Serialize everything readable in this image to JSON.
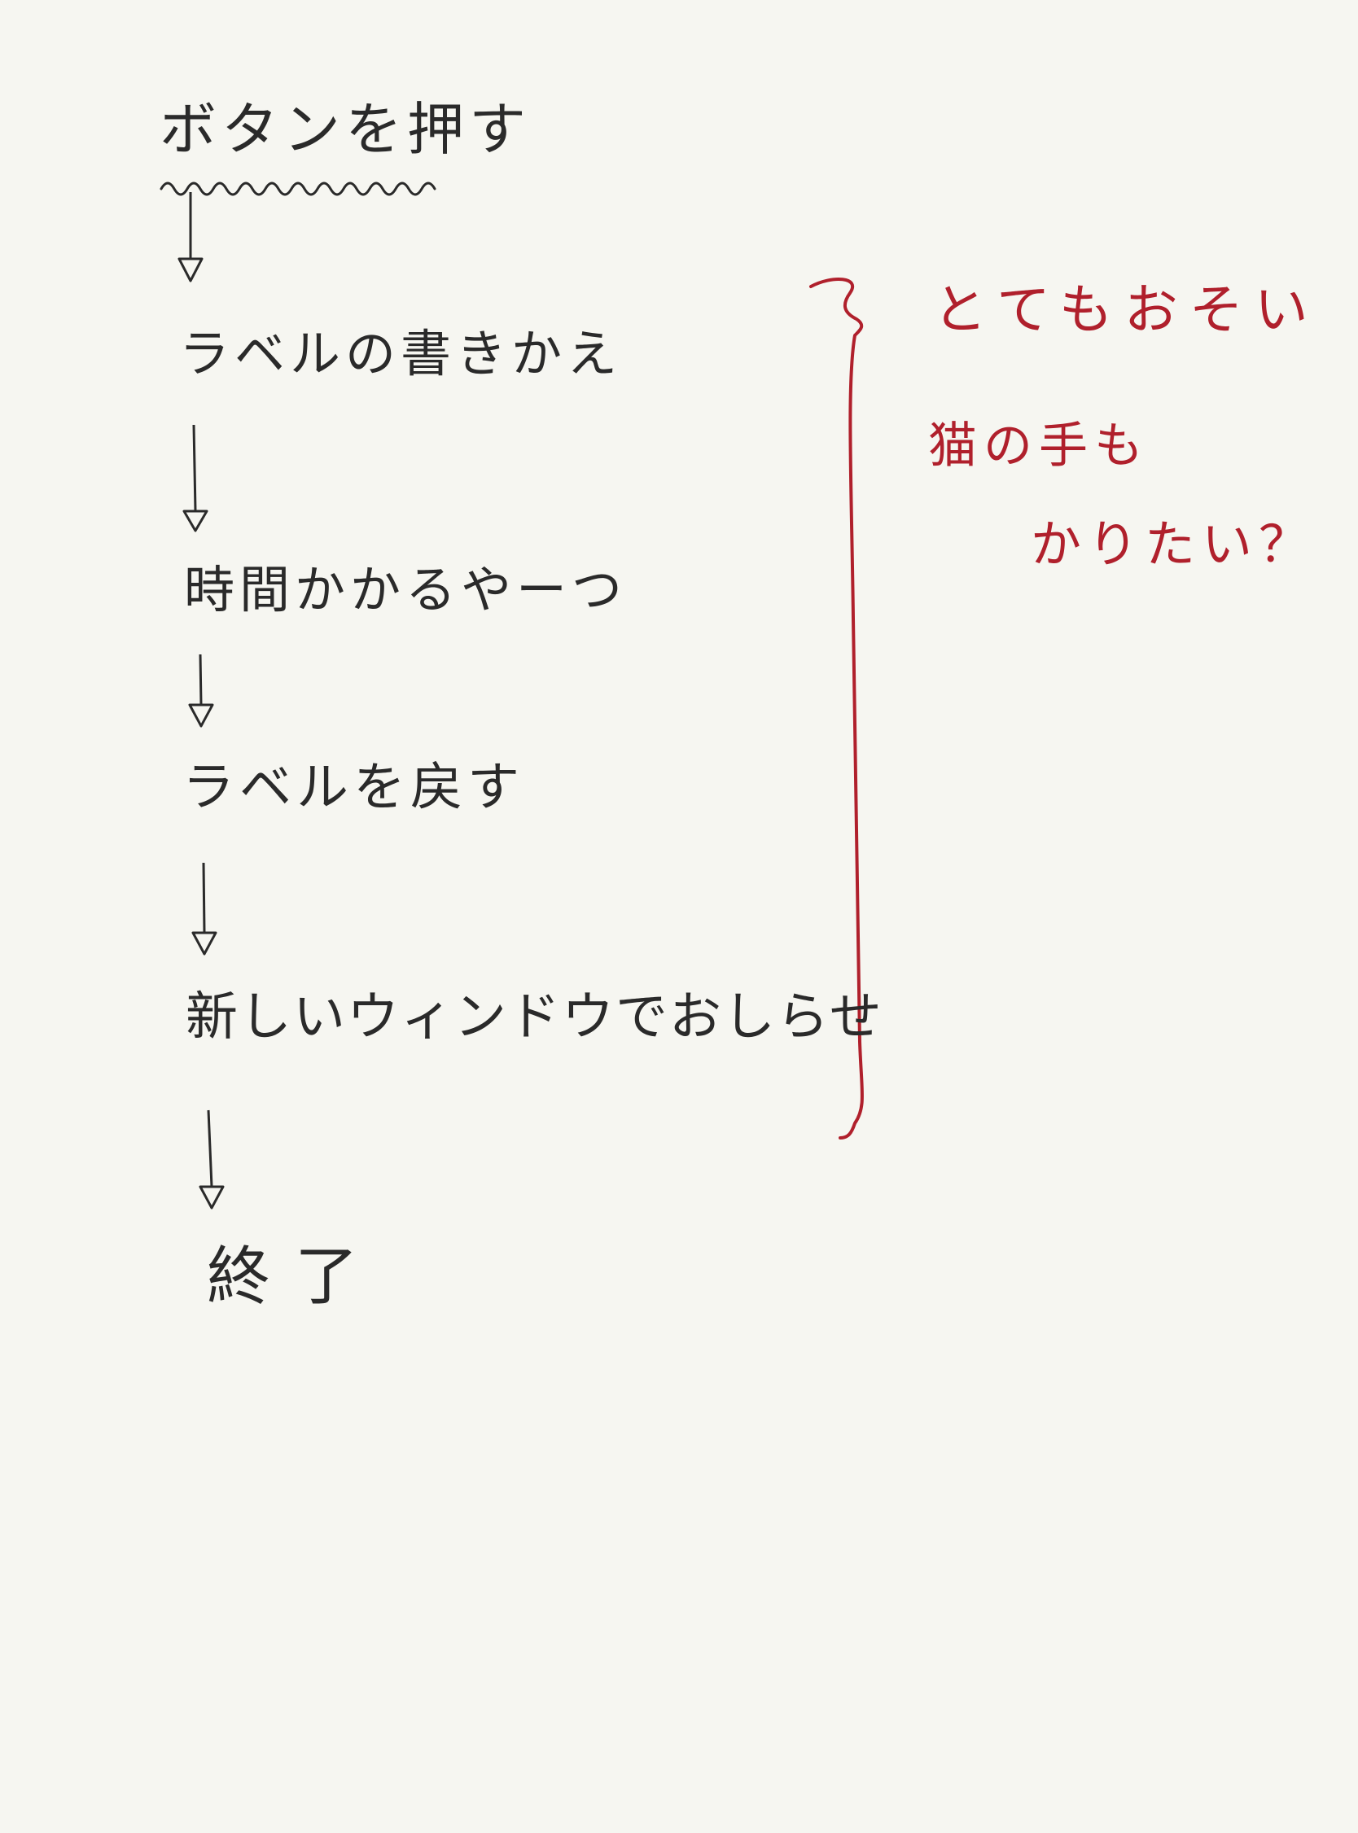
{
  "flow": {
    "steps": [
      "ボタンを押す",
      "ラベルの書きかえ",
      "時間かかるやーつ",
      "ラベルを戻す",
      "新しいウィンドウでおしらせ",
      "終了"
    ]
  },
  "comment": {
    "line1": "とてもおそい",
    "line2": "猫の手も",
    "line3": "かりたい？"
  },
  "colors": {
    "ink": "#2a2a2a",
    "red_ink": "#b0202c",
    "paper": "#f6f6f1"
  }
}
